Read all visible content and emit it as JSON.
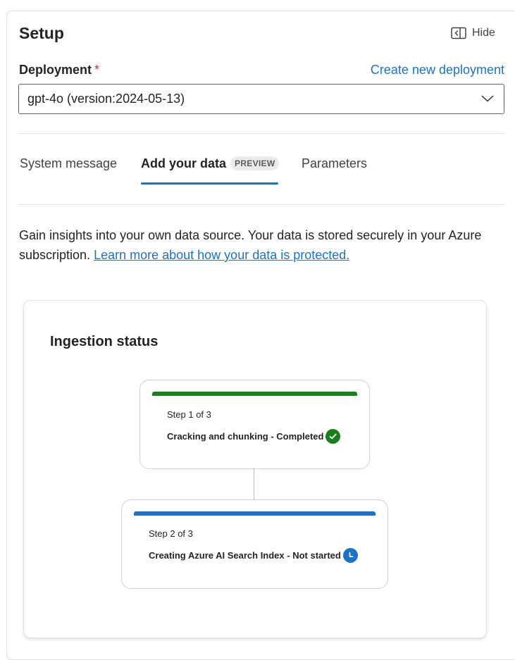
{
  "header": {
    "title": "Setup",
    "hide_label": "Hide"
  },
  "deployment": {
    "label": "Deployment",
    "required_marker": "*",
    "create_link": "Create new deployment",
    "selected_value": "gpt-4o (version:2024-05-13)"
  },
  "tabs": [
    {
      "label": "System message"
    },
    {
      "label": "Add your data",
      "badge": "PREVIEW",
      "active": true
    },
    {
      "label": "Parameters"
    }
  ],
  "description": {
    "text": "Gain insights into your own data source. Your data is stored securely in your Azure subscription. ",
    "link": "Learn more about how your data is protected."
  },
  "ingestion": {
    "title": "Ingestion status",
    "steps": [
      {
        "step_label": "Step 1 of 3",
        "status_text": "Cracking and chunking - Completed",
        "icon": "checkmark-circle-icon",
        "color": "#1b7d1b"
      },
      {
        "step_label": "Step 2 of 3",
        "status_text": "Creating Azure AI Search Index - Not started",
        "icon": "clock-icon",
        "color": "#1a73c8"
      }
    ]
  },
  "colors": {
    "accent": "#1a73c8",
    "success": "#1b7d1b",
    "required": "#c4314b"
  }
}
